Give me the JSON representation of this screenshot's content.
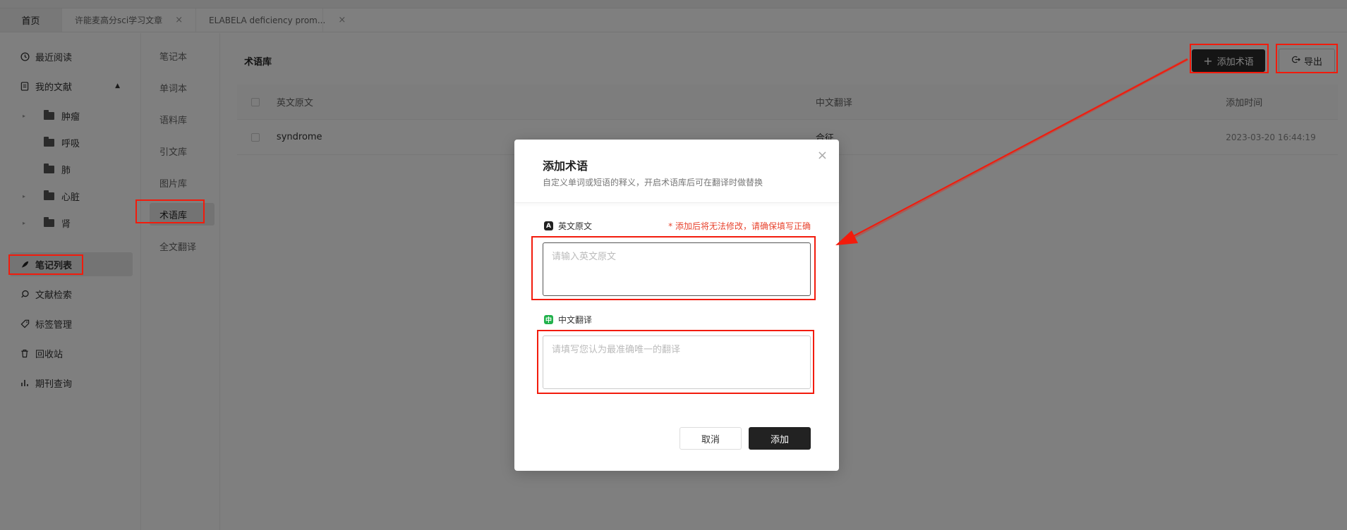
{
  "tabs": [
    {
      "label": "首页"
    },
    {
      "label": "许能麦高分sci学习文章"
    },
    {
      "label": "ELABELA deficiency prom..."
    }
  ],
  "tab_close": "×",
  "sidebar": {
    "items": [
      {
        "label": "最近阅读",
        "icon": "clock-icon"
      },
      {
        "label": "我的文献",
        "icon": "document-icon"
      },
      {
        "label": "肿瘤",
        "icon": "folder-icon"
      },
      {
        "label": "呼吸",
        "icon": "folder-icon"
      },
      {
        "label": "肺",
        "icon": "folder-icon"
      },
      {
        "label": "心脏",
        "icon": "folder-icon"
      },
      {
        "label": "肾",
        "icon": "folder-icon"
      },
      {
        "label": "笔记列表",
        "icon": "feather-icon"
      },
      {
        "label": "文献检索",
        "icon": "search-icon"
      },
      {
        "label": "标签管理",
        "icon": "tag-icon"
      },
      {
        "label": "回收站",
        "icon": "trash-icon"
      },
      {
        "label": "期刊查询",
        "icon": "bar-chart-icon"
      }
    ]
  },
  "subnav": {
    "items": [
      {
        "label": "笔记本"
      },
      {
        "label": "单词本"
      },
      {
        "label": "语料库"
      },
      {
        "label": "引文库"
      },
      {
        "label": "图片库"
      },
      {
        "label": "术语库"
      },
      {
        "label": "全文翻译"
      }
    ]
  },
  "main": {
    "title": "术语库",
    "add_button": "添加术语",
    "export_button": "导出",
    "columns": [
      "英文原文",
      "中文翻译",
      "添加时间"
    ],
    "rows": [
      {
        "en": "syndrome",
        "zh": "合征",
        "time": "2023-03-20 16:44:19"
      }
    ]
  },
  "modal": {
    "title": "添加术语",
    "subtitle": "自定义单词或短语的释义，开启术语库后可在翻译时做替换",
    "en_label": "英文原文",
    "en_badge": "A",
    "warning": "* 添加后将无法修改，请确保填写正确",
    "en_placeholder": "请输入英文原文",
    "zh_label": "中文翻译",
    "zh_badge": "中",
    "zh_placeholder": "请填写您认为最准确唯一的翻译",
    "cancel": "取消",
    "confirm": "添加",
    "close": "×"
  },
  "colors": {
    "annotation_red": "#f21b0c",
    "primary_dark": "#222222",
    "warning_text": "#e8442f",
    "zh_badge_green": "#22b14c"
  }
}
